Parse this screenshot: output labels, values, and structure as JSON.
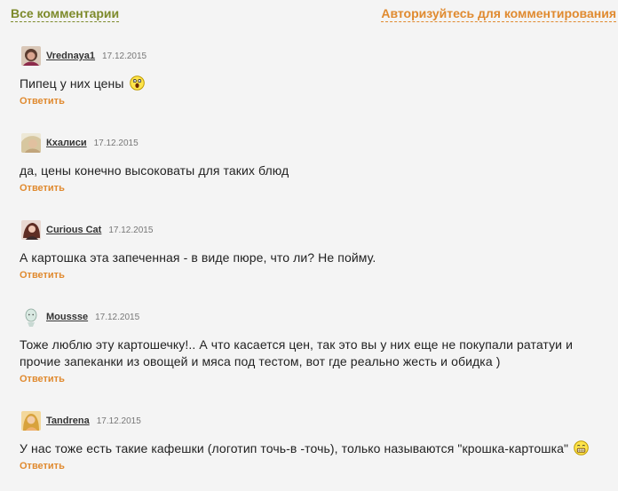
{
  "header": {
    "all_comments": "Все комментарии",
    "auth_prompt": "Авторизуйтесь для комментирования"
  },
  "colors": {
    "green_link": "#7d8a2b",
    "orange_link": "#e08a2f",
    "text": "#222222",
    "background": "#f4f4f4"
  },
  "comments": [
    {
      "author": "Vrednaya1",
      "date": "17.12.2015",
      "text": "Пипец у них цены",
      "emoji": "shocked-emoji-icon",
      "reply": "Ответить"
    },
    {
      "author": "Кхалиси",
      "date": "17.12.2015",
      "text": "да, цены конечно высоковаты для таких блюд",
      "reply": "Ответить"
    },
    {
      "author": "Curious Cat",
      "date": "17.12.2015",
      "text": "А картошка эта запеченная - в виде пюре, что ли? Не пойму.",
      "reply": "Ответить"
    },
    {
      "author": "Moussse",
      "date": "17.12.2015",
      "text": "Тоже люблю эту картошечку!.. А что касается цен, так это вы у них еще не покупали рататуи и прочие запеканки из овощей и мяса под тестом, вот где реально жесть и обидка )",
      "reply": "Ответить"
    },
    {
      "author": "Tandrena",
      "date": "17.12.2015",
      "text": "У нас тоже есть такие кафешки (логотип точь-в -точь), только называются \"крошка-картошка\"",
      "emoji": "grinning-emoji-icon",
      "reply": "Ответить"
    }
  ]
}
